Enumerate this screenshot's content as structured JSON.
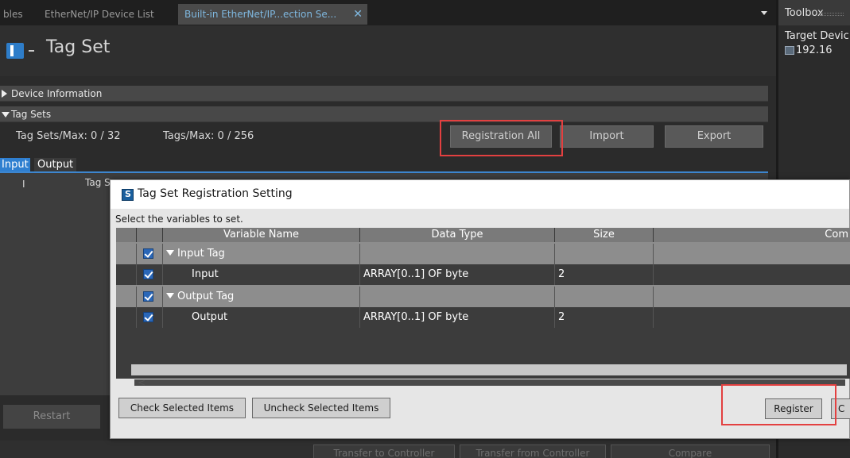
{
  "tabs": [
    {
      "label": "bles"
    },
    {
      "label": "EtherNet/IP Device List"
    },
    {
      "label": "Built-in EtherNet/IP...ection Se...",
      "close": "✕"
    }
  ],
  "header": {
    "title": "Tag Set"
  },
  "sections": {
    "device_information": "Device Information",
    "tag_sets": "Tag Sets"
  },
  "stats": {
    "tag_sets_max": "Tag Sets/Max:  0  /  32",
    "tags_max": "Tags/Max:  0  /  256"
  },
  "buttons": {
    "registration_all": "Registration All",
    "import": "Import",
    "export": "Export",
    "restart": "Restart"
  },
  "subtabs": {
    "input": "Input",
    "output": "Output"
  },
  "grid_columns": {
    "i": "I",
    "tag": "Tag S"
  },
  "bottom_buttons": [
    "Transfer to Controller",
    "Transfer from Controller",
    "Compare"
  ],
  "toolbox": {
    "title": "Toolbox",
    "target": "Target Devic",
    "ip": "192.16"
  },
  "dialog": {
    "title": "Tag Set Registration Setting",
    "prompt": "Select the variables to set.",
    "columns": [
      "Variable Name",
      "Data Type",
      "Size",
      "Com"
    ],
    "rows": [
      {
        "name": "Input Tag",
        "type": "",
        "size": "",
        "group": true
      },
      {
        "name": "Input",
        "type": "ARRAY[0..1] OF byte",
        "size": "2",
        "group": false
      },
      {
        "name": "Output Tag",
        "type": "",
        "size": "",
        "group": true
      },
      {
        "name": "Output",
        "type": "ARRAY[0..1] OF byte",
        "size": "2",
        "group": false
      }
    ],
    "buttons": {
      "check": "Check Selected Items",
      "uncheck": "Uncheck Selected Items",
      "register": "Register",
      "cancel": "C"
    }
  },
  "colors": {
    "accent_blue": "#2f7fd0",
    "highlight_red": "#e34040",
    "checkbox_blue": "#2a67b8"
  }
}
